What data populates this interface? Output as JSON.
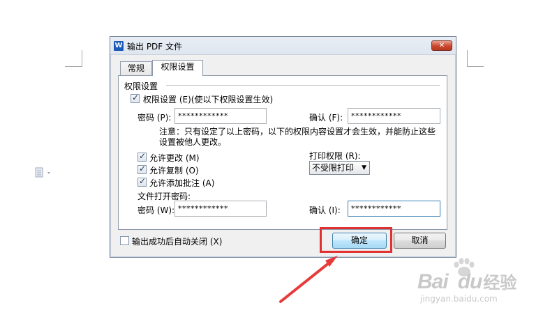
{
  "dialog": {
    "title": "输出 PDF 文件",
    "app_icon": "W",
    "close_symbol": "✕"
  },
  "tabs": [
    {
      "label": "常规",
      "active": false
    },
    {
      "label": "权限设置",
      "active": true
    }
  ],
  "permissions": {
    "group_title": "权限设置",
    "enable_checkbox": {
      "label": "权限设置 (E)(使以下权限设置生效)",
      "checked": true
    },
    "password_label": "密码 (P):",
    "password_value": "************",
    "confirm_label": "确认 (F):",
    "confirm_value": "************",
    "note": "注意：只有设定了以上密码，以下的权限内容设置才会生效，并能防止这些设置被他人更改。",
    "allow_change": {
      "label": "允许更改 (M)",
      "checked": true
    },
    "allow_copy": {
      "label": "允许复制 (O)",
      "checked": true
    },
    "allow_annotate": {
      "label": "允许添加批注 (A)",
      "checked": true
    },
    "print_label": "打印权限 (R):",
    "print_value": "不受限打印",
    "open_password_title": "文件打开密码:",
    "open_password_label": "密码 (W):",
    "open_password_value": "************",
    "open_confirm_label": "确认 (I):",
    "open_confirm_value": "************"
  },
  "footer": {
    "auto_close": {
      "label": "输出成功后自动关闭 (X)",
      "checked": false
    },
    "ok_label": "确定",
    "cancel_label": "取消"
  },
  "watermark": {
    "brand": "Bai",
    "brand2": "du",
    "cn": "经验",
    "url": "jingyan.baidu.com"
  },
  "colors": {
    "highlight": "#e03030",
    "arrow": "#e83a3a"
  }
}
